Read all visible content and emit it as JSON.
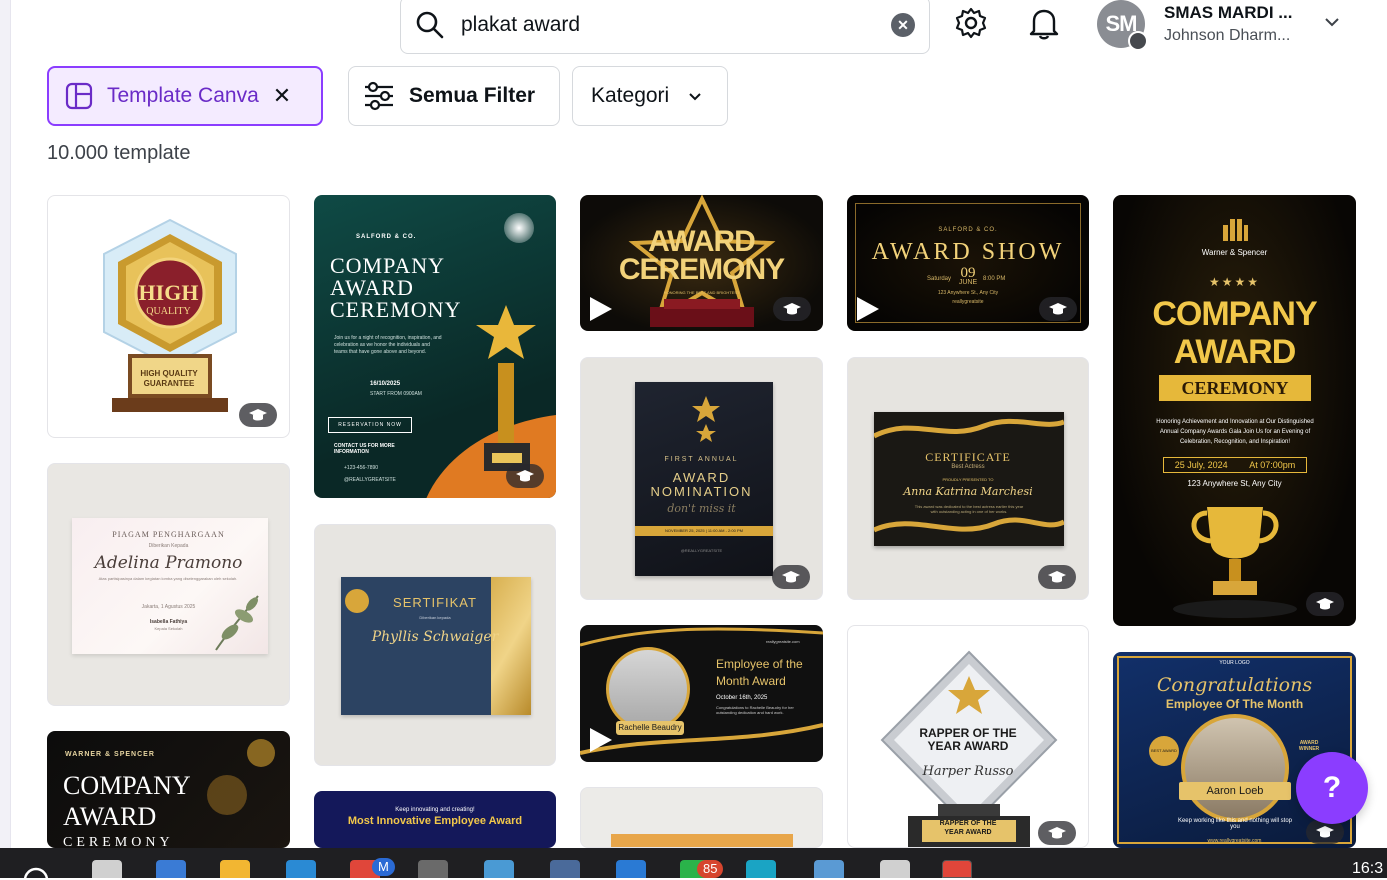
{
  "search": {
    "query": "plakat award",
    "clear_icon": "x-circle-icon",
    "search_icon": "search-icon"
  },
  "header": {
    "avatar_initials": "SM",
    "account_name": "SMAS MARDI ...",
    "account_sub": "Johnson Dharm...",
    "icons": [
      "gear-icon",
      "bell-icon",
      "chevron-down-icon"
    ]
  },
  "filters": {
    "template_chip": "Template Canva",
    "template_chip_remove": "✕",
    "all_filters": "Semua Filter",
    "category": "Kategori"
  },
  "results_count": "10.000 template",
  "cards": {
    "c1": {
      "title": "HIGH",
      "sub": "QUALITY",
      "plaque": "HIGH QUALITY GUARANTEE"
    },
    "c2": {
      "brand": "SALFORD & CO.",
      "title1": "COMPANY",
      "title2": "AWARD",
      "title3": "CEREMONY",
      "body": "Join us for a night of recognition, inspiration, and celebration as we honor the individuals and teams that have gone above and beyond.",
      "date": "16/10/2025",
      "time": "START FROM 0900AM",
      "cta": "RESERVATION NOW",
      "contact": "CONTACT US FOR MORE INFORMATION",
      "phone": "+123-456-7890",
      "handle": "@REALLYGREATSITE"
    },
    "c3": {
      "title1": "AWARD",
      "title2": "CEREMONY",
      "sub": "HONORING THE BEST AND BRIGHTEST"
    },
    "c4": {
      "brand": "SALFORD & CO.",
      "title": "AWARD SHOW",
      "day": "Saturday",
      "date": "09",
      "month": "JUNE",
      "time": "8:00 PM",
      "address": "123 Anywhere St., Any City",
      "site": "reallygreatsite"
    },
    "c5": {
      "brand": "Warner & Spencer",
      "title1": "COMPANY",
      "title2": "AWARD",
      "title3": "CEREMONY",
      "body": "Honoring Achievement and Innovation at Our Distinguished Annual Company Awards Gala Join Us for an Evening of Celebration, Recognition, and Inspiration!",
      "date": "25 July, 2024",
      "time": "At 07:00pm",
      "address": "123 Anywhere St, Any City"
    },
    "c6": {
      "title": "PIAGAM PENGHARGAAN",
      "presented": "Diberikan Kepada",
      "name": "Adelina Pramono",
      "body": "Atas partisipasinya dalam kegiatan lomba yang diselenggarakan oleh sekolah.",
      "place": "Jakarta, 1 Agustus 2025",
      "signer": "Isabella Fathiya",
      "signer_role": "Kepala Sekolah"
    },
    "c7": {
      "title1": "FIRST ANNUAL",
      "title2": "AWARD",
      "title3": "NOMINATION",
      "script": "don't miss it",
      "date": "NOVEMBER 25, 2025 | 11:00 AM - 2:00 PM",
      "handle": "@REALLYGREATSITE"
    },
    "c8": {
      "title": "CERTIFICATE",
      "sub": "Best Actress",
      "presented": "PROUDLY PRESENTED TO",
      "name": "Anna Katrina Marchesi",
      "body": "This award was dedicated to the best actress earlier this year with outstanding acting in one of her works."
    },
    "c9": {
      "title": "SERTIFIKAT",
      "sub": "Diberikan kepada",
      "name": "Phyllis Schwaiger"
    },
    "c10": {
      "title1": "Employee of the",
      "title2": "Month Award",
      "date": "October 16th, 2025",
      "name": "Rachelle Beaudry",
      "site": "reallygreatsite.com",
      "body": "Congratulations to Rachelle Beaudry for her outstanding dedication and hard work."
    },
    "c11": {
      "title1": "RAPPER OF THE",
      "title2": "YEAR AWARD",
      "name": "Harper Russo",
      "plaque1": "RAPPER OF THE",
      "plaque2": "YEAR AWARD"
    },
    "c12": {
      "brand": "WARNER & SPENCER",
      "title1": "COMPANY",
      "title2": "AWARD",
      "title3": "CEREMONY"
    },
    "c13": {
      "sub": "Keep innovating and creating!",
      "title": "Most Innovative Employee Award"
    },
    "c14": {
      "logo": "YOUR LOGO",
      "script": "Congratulations",
      "title": "Employee Of The Month",
      "badge": "BEST AWARD",
      "badge2": "AWARD WINNER",
      "name": "Aaron Loeb",
      "quote": "Keep working like this and nothing will stop you",
      "site": "www.reallygreatsite.com"
    }
  },
  "help_label": "?",
  "taskbar": {
    "badge_mail": "M",
    "badge_count": "85",
    "clock": "16:3"
  }
}
